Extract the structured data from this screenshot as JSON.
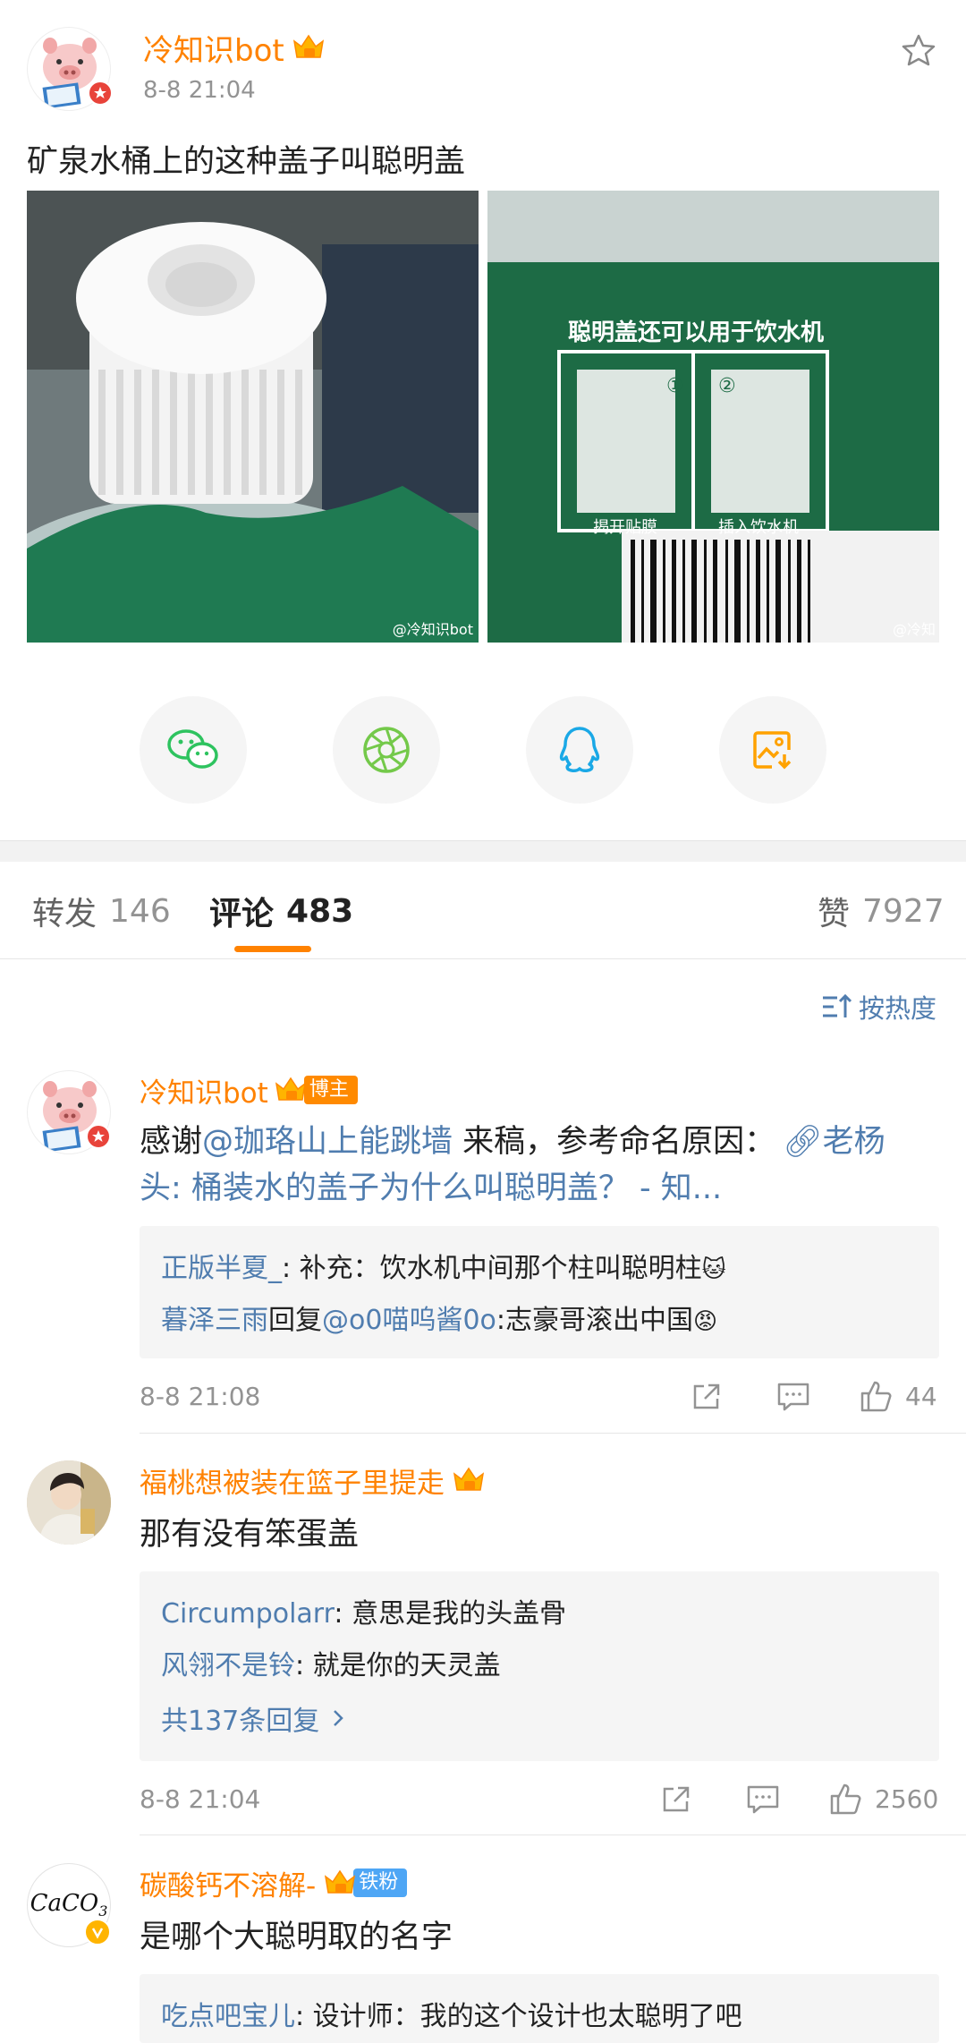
{
  "post": {
    "author": "冷知识bot",
    "time": "8-8 21:04",
    "text": "矿泉水桶上的这种盖子叫聪明盖",
    "image1_watermark": "@冷知识bot",
    "image2_watermark": "@冷知",
    "image2": {
      "headline": "聪明盖还可以用于饮水机",
      "step1": "揭开贴膜",
      "step2": "插入饮水机",
      "num1": "①",
      "num2": "②"
    }
  },
  "share": [
    "wechat-icon",
    "moments-icon",
    "qq-icon",
    "save-image-icon"
  ],
  "tabs": {
    "repost_label": "转发",
    "repost_count": "146",
    "comment_label": "评论",
    "comment_count": "483",
    "like_label": "赞",
    "like_count": "7927"
  },
  "sort_label": "按热度",
  "comments": [
    {
      "name": "冷知识bot",
      "tag": "博主",
      "text_line1_prefix": "感谢",
      "text_line1_mention": "@珈珞山上能跳墙",
      "text_line1_rest": " 来稿，参考命名原因：",
      "link_line1": "老杨",
      "link_line2": "头: 桶装水的盖子为什么叫聪明盖？ - 知...",
      "replies": [
        {
          "user": "正版半夏_",
          "text": ": 补充：饮水机中间那个柱叫聪明柱",
          "emoji": "🐱"
        },
        {
          "user": "暮泽三雨",
          "mid": "回复",
          "mention": "@o0喵呜酱0o",
          "text": ":志豪哥滚出中国",
          "emoji": "😡"
        }
      ],
      "time": "8-8 21:08",
      "likes": "44"
    },
    {
      "name": "福桃想被装在篮子里提走",
      "text": "那有没有笨蛋盖",
      "replies": [
        {
          "user": "Circumpolarr",
          "text": ": 意思是我的头盖骨"
        },
        {
          "user": "风翎不是铃",
          "text": ": 就是你的天灵盖"
        }
      ],
      "more": "共137条回复",
      "time": "8-8 21:04",
      "likes": "2560"
    },
    {
      "name": "碳酸钙不溶解-",
      "tag": "铁粉",
      "text": "是哪个大聪明取的名字",
      "avatar_text": "CaCO",
      "avatar_sub": "3",
      "replies": [
        {
          "user": "吃点吧宝儿",
          "text": ": 设计师：我的这个设计也太聪明了吧"
        }
      ]
    }
  ],
  "colors": {
    "accent": "#ff8200",
    "link": "#507daf",
    "muted": "#939393",
    "bg_gray": "#f5f5f5"
  }
}
